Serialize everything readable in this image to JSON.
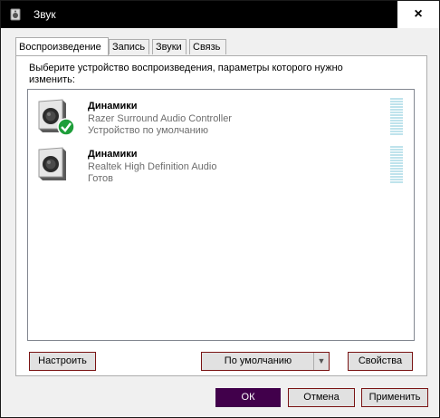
{
  "window": {
    "title": "Звук",
    "close_label": "×"
  },
  "tabs": [
    {
      "label": "Воспроизведение",
      "active": true
    },
    {
      "label": "Запись",
      "active": false
    },
    {
      "label": "Звуки",
      "active": false
    },
    {
      "label": "Связь",
      "active": false
    }
  ],
  "panel": {
    "instruction": "Выберите устройство воспроизведения, параметры которого нужно изменить:"
  },
  "devices": [
    {
      "name": "Динамики",
      "description": "Razer Surround Audio Controller",
      "status": "Устройство по умолчанию",
      "default": true,
      "icon": "speaker-icon"
    },
    {
      "name": "Динамики",
      "description": "Realtek High Definition Audio",
      "status": "Готов",
      "default": false,
      "icon": "speaker-icon"
    }
  ],
  "buttons": {
    "configure": "Настроить",
    "set_default": "По умолчанию",
    "properties": "Свойства",
    "ok": "ОК",
    "cancel": "Отмена",
    "apply": "Применить"
  },
  "colors": {
    "accent_ok": "#41004b",
    "check_green": "#1e9e3a",
    "meter": "#bfe3ec",
    "button_border": "#7a1414"
  }
}
